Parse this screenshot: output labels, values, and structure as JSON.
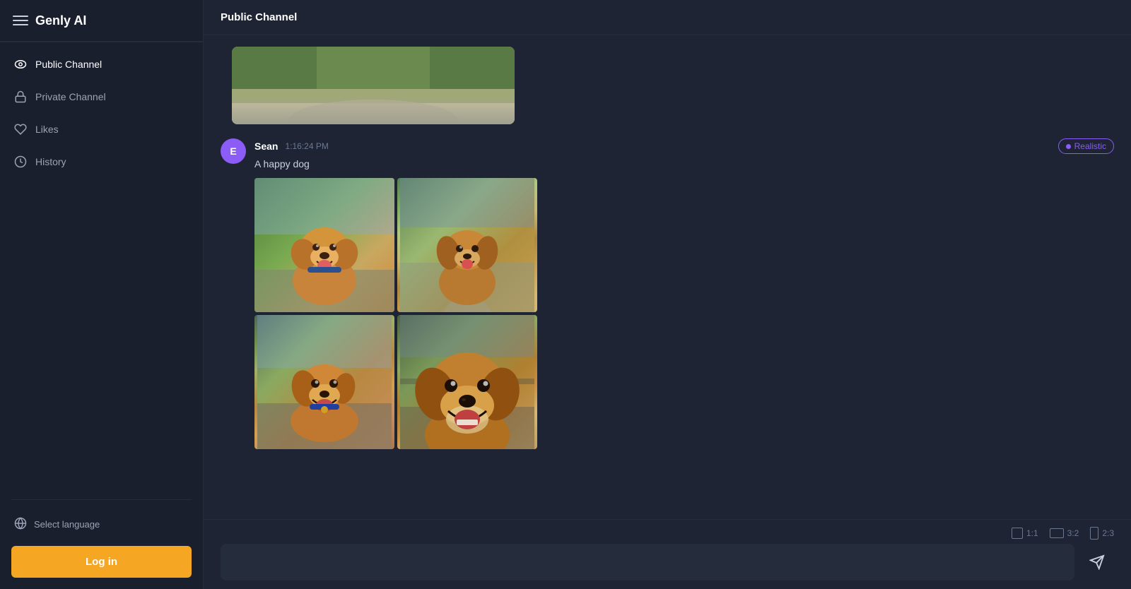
{
  "app": {
    "title": "Genly AI"
  },
  "sidebar": {
    "nav_items": [
      {
        "id": "public-channel",
        "label": "Public Channel",
        "icon": "eye"
      },
      {
        "id": "private-channel",
        "label": "Private Channel",
        "icon": "lock"
      },
      {
        "id": "likes",
        "label": "Likes",
        "icon": "heart"
      },
      {
        "id": "history",
        "label": "History",
        "icon": "clock"
      }
    ],
    "select_language": "Select language",
    "login_label": "Log in"
  },
  "main": {
    "header": "Public Channel",
    "message": {
      "username": "Sean",
      "time": "1:16:24 PM",
      "badge": "Realistic",
      "text": "A happy dog",
      "avatar_letter": "E"
    },
    "ratio_options": [
      {
        "id": "1-1",
        "label": "1:1",
        "active": false
      },
      {
        "id": "3-2",
        "label": "3:2",
        "active": false
      },
      {
        "id": "2-3",
        "label": "2:3",
        "active": false
      }
    ],
    "input_placeholder": ""
  }
}
